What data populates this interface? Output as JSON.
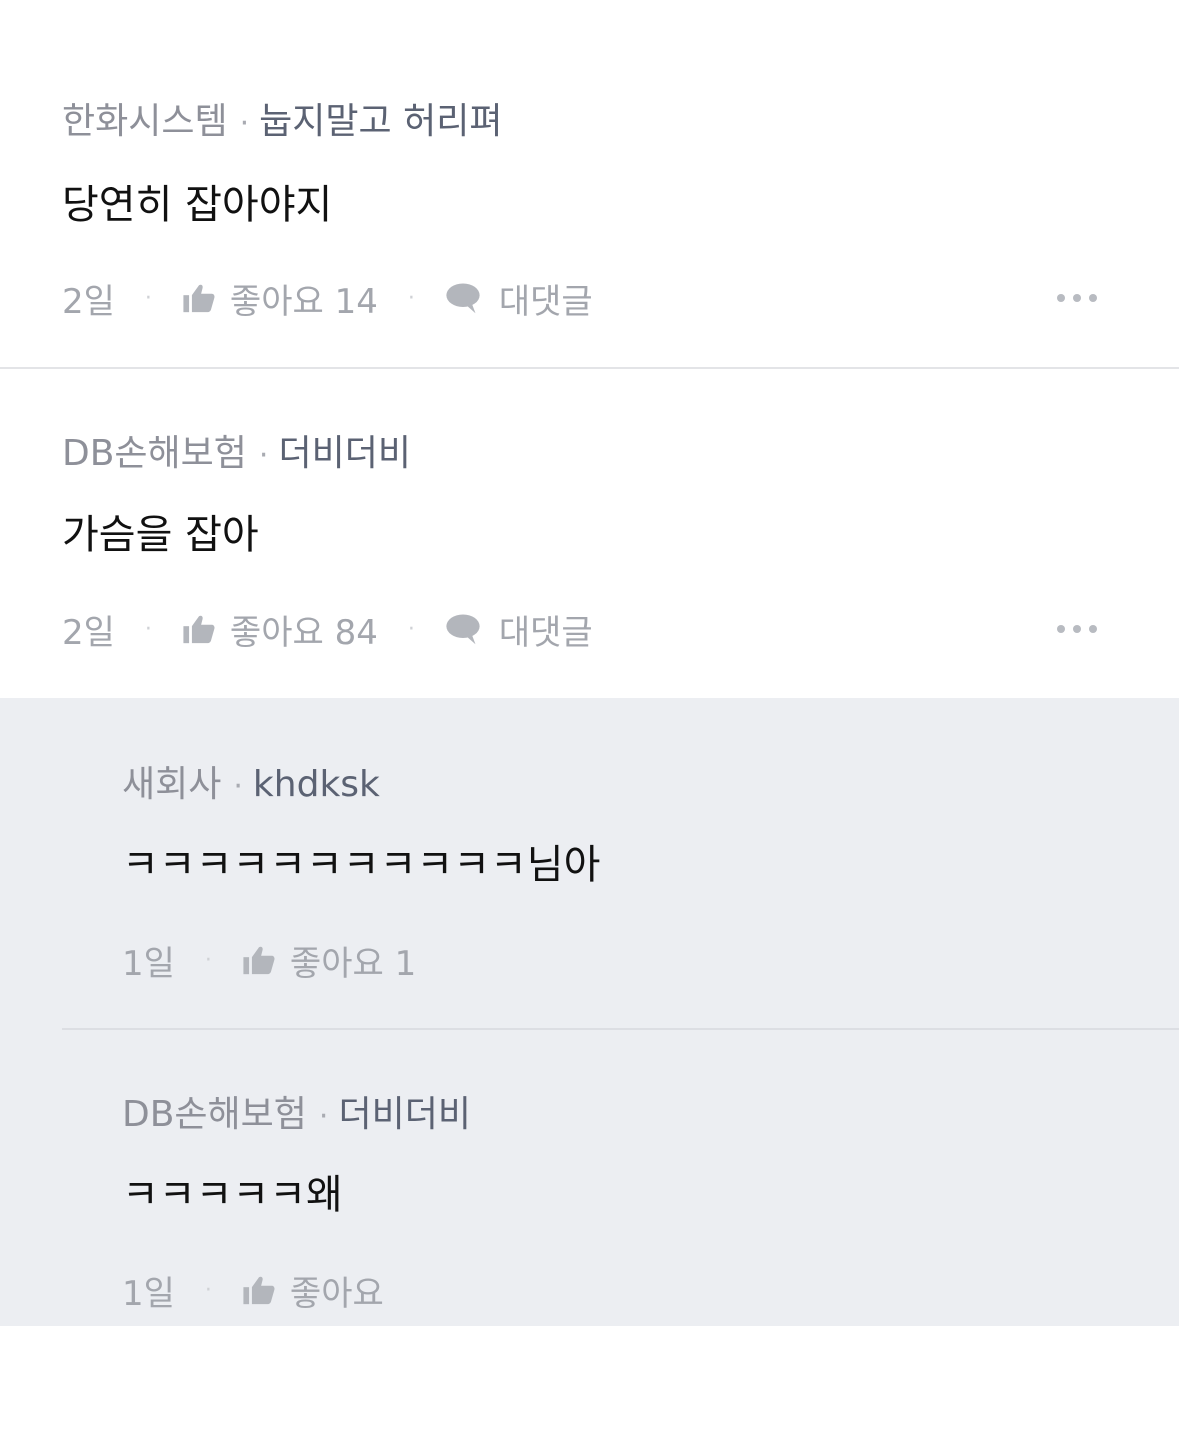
{
  "comments": [
    {
      "company": "한화시스템",
      "separator": "·",
      "nickname": "눕지말고 허리펴",
      "text": "당연히 잡아야지",
      "time": "2일",
      "like_label": "좋아요 14",
      "reply_label": "대댓글"
    },
    {
      "company": "DB손해보험",
      "separator": "·",
      "nickname": "더비더비",
      "text": "가슴을 잡아",
      "time": "2일",
      "like_label": "좋아요 84",
      "reply_label": "대댓글"
    }
  ],
  "replies": [
    {
      "company": "새회사",
      "separator": "·",
      "nickname": "khdksk",
      "text": "ㅋㅋㅋㅋㅋㅋㅋㅋㅋㅋㅋ님아",
      "time": "1일",
      "like_label": "좋아요 1"
    },
    {
      "company": "DB손해보험",
      "separator": "·",
      "nickname": "더비더비",
      "text": "ㅋㅋㅋㅋㅋ왜",
      "time": "1일",
      "like_label": "좋아요"
    }
  ],
  "icons": {
    "like": "thumbs-up-icon",
    "reply": "speech-bubble-icon",
    "more": "more-dots-icon"
  },
  "colors": {
    "reply_background": "#eceef2",
    "meta_text": "#8e9099",
    "nickname_text": "#5b6273",
    "body_text": "#111111",
    "action_text": "#a3a6ad"
  }
}
